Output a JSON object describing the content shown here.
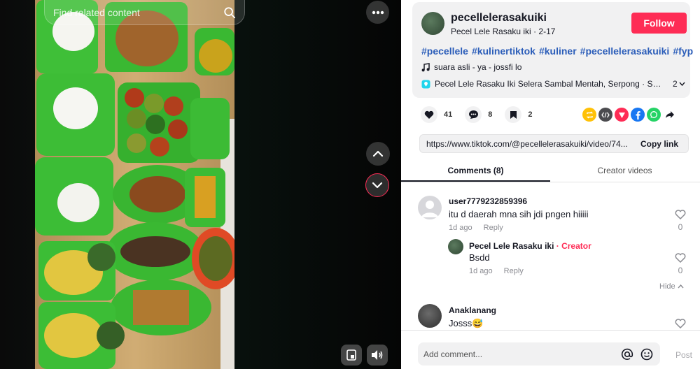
{
  "video": {
    "search_placeholder": "Find related content",
    "icons": {
      "search": "search-icon",
      "more": "more-horizontal-icon",
      "prev": "chevron-up-icon",
      "next": "chevron-down-icon",
      "floating": "floating-player-icon",
      "volume": "volume-icon"
    }
  },
  "author": {
    "username": "pecellelerasakuiki",
    "nickname": "Pecel Lele Rasaku iki",
    "separator": " · ",
    "date": "2-17",
    "follow_label": "Follow"
  },
  "description": {
    "hashtags": [
      "#pecellele",
      "#kulinertiktok",
      "#kuliner",
      "#pecellelerasakuiki",
      "#fyp"
    ]
  },
  "music": {
    "text": "suara asli - ya - jossfi lo"
  },
  "location": {
    "text": "Pecel Lele Rasaku Iki Selera Sambal Mentah, Serpong · South Tang…",
    "count": "2"
  },
  "actions": {
    "likes": "41",
    "comments": "8",
    "saves": "2"
  },
  "share_icons": [
    "repost-icon",
    "embed-icon",
    "send-icon",
    "facebook-icon",
    "whatsapp-icon",
    "share-arrow-icon"
  ],
  "link": {
    "url": "https://www.tiktok.com/@pecellelerasakuiki/video/74...",
    "copy_label": "Copy link"
  },
  "tabs": {
    "comments": "Comments (8)",
    "creator": "Creator videos"
  },
  "comments": [
    {
      "user": "user7779232859396",
      "text": "itu d daerah mna sih jdi pngen hiiiii",
      "time": "1d ago",
      "reply": "Reply",
      "likes": "0"
    },
    {
      "user": "Pecel Lele Rasaku iki",
      "badge": " · Creator",
      "text": "Bsdd",
      "time": "1d ago",
      "reply": "Reply",
      "likes": "0"
    },
    {
      "user": "Anaklanang",
      "text": "Josss😅"
    }
  ],
  "hide_label": "Hide",
  "comment_box": {
    "placeholder": "Add comment...",
    "post_label": "Post"
  },
  "colors": {
    "accent": "#fe2c55",
    "hashtag": "#2b5db9",
    "panel": "#f1f1f2"
  }
}
